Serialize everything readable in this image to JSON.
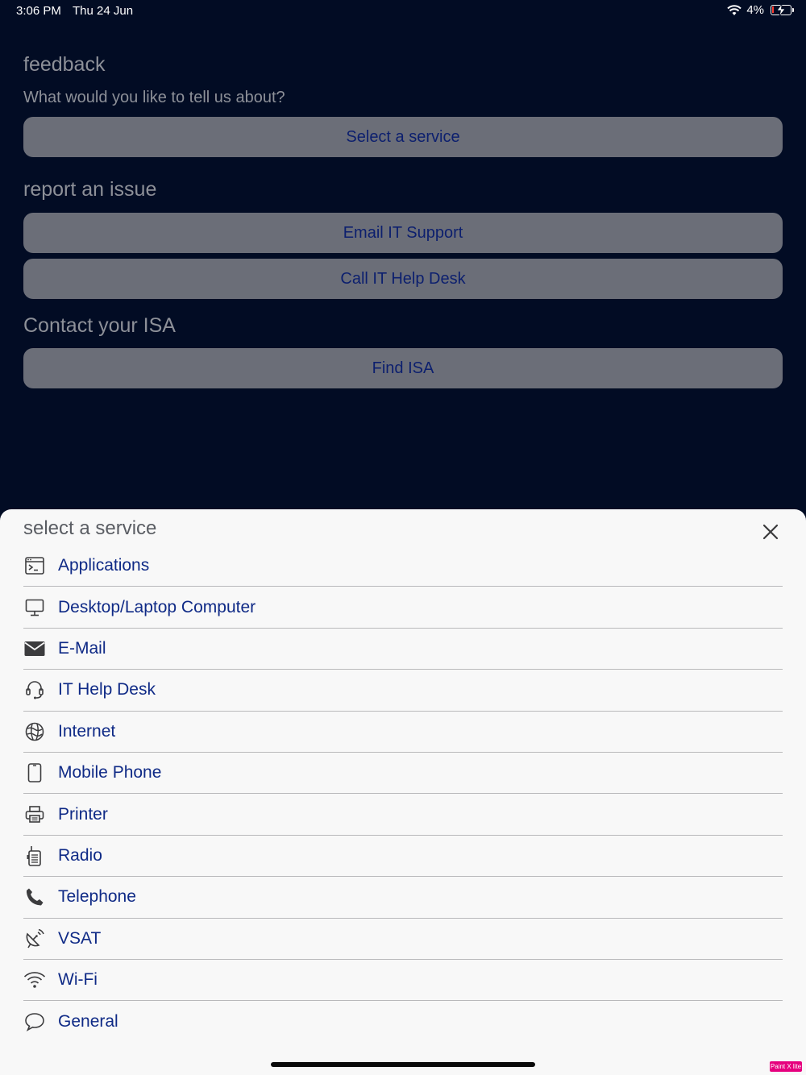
{
  "status_bar": {
    "time": "3:06 PM",
    "date": "Thu 24 Jun",
    "battery": "4%"
  },
  "page": {
    "feedback_title": "feedback",
    "feedback_prompt": "What would you like to tell us about?",
    "select_service_label": "Select a service",
    "report_title": "report an issue",
    "email_label": "Email IT Support",
    "call_label": "Call IT Help Desk",
    "contact_title": "Contact your ISA",
    "find_isa_label": "Find ISA"
  },
  "sheet": {
    "title": "select a service",
    "items": [
      {
        "label": "Applications",
        "icon": "terminal-window-icon"
      },
      {
        "label": "Desktop/Laptop Computer",
        "icon": "desktop-icon"
      },
      {
        "label": "E-Mail",
        "icon": "envelope-icon"
      },
      {
        "label": "IT Help Desk",
        "icon": "headset-icon"
      },
      {
        "label": "Internet",
        "icon": "globe-icon"
      },
      {
        "label": "Mobile Phone",
        "icon": "mobile-phone-icon"
      },
      {
        "label": "Printer",
        "icon": "printer-icon"
      },
      {
        "label": "Radio",
        "icon": "radio-icon"
      },
      {
        "label": "Telephone",
        "icon": "telephone-icon"
      },
      {
        "label": "VSAT",
        "icon": "satellite-dish-icon"
      },
      {
        "label": "Wi-Fi",
        "icon": "wifi-icon"
      },
      {
        "label": "General",
        "icon": "speech-bubble-icon"
      }
    ]
  },
  "watermark": "Paint X lite",
  "colors": {
    "background": "#020c24",
    "button_bg": "#6b6e78",
    "button_text": "#0c1f6e",
    "sheet_bg": "#f8f8f8",
    "item_text": "#0f2a86"
  }
}
